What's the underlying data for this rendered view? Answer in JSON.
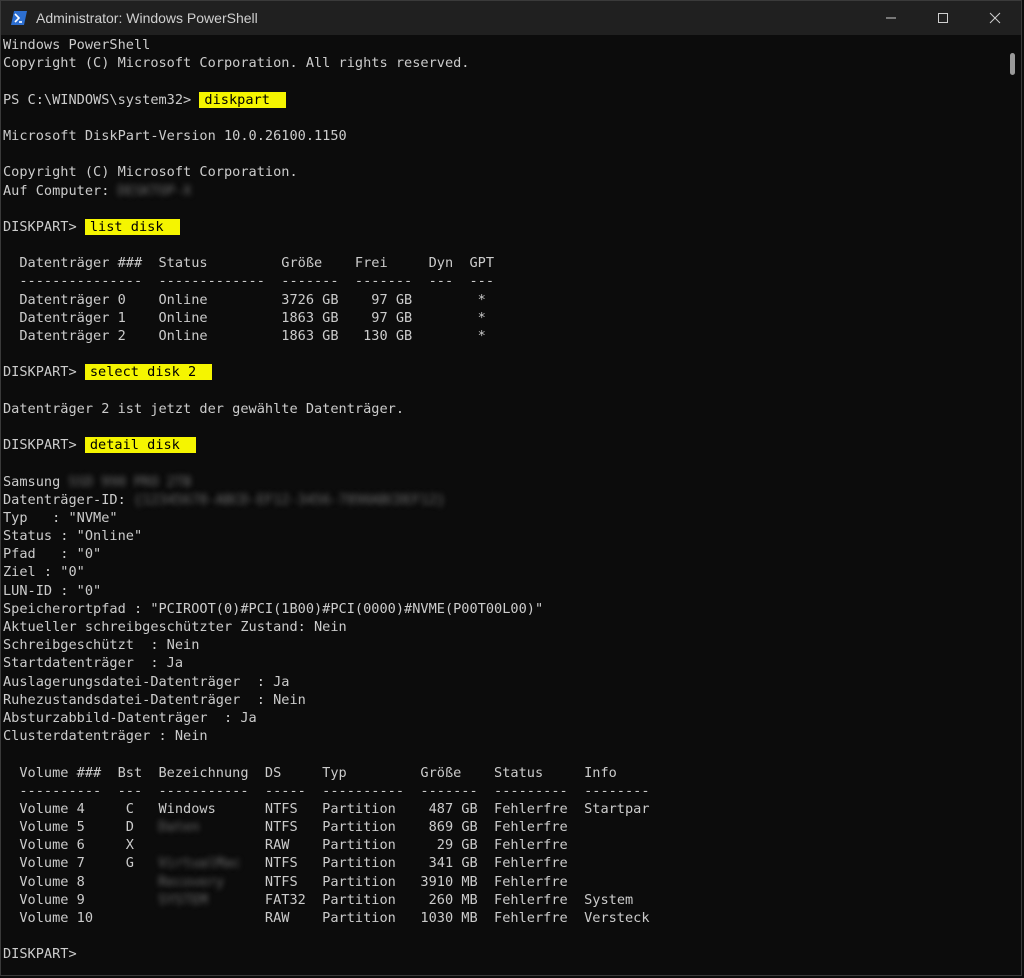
{
  "window": {
    "title": "Administrator: Windows PowerShell",
    "icon": "powershell-icon",
    "controls": {
      "minimize": "minimize-icon",
      "maximize": "maximize-icon",
      "close": "close-icon"
    }
  },
  "colors": {
    "background": "#0c0c0c",
    "text": "#cccccc",
    "highlight": "#f5f500",
    "titlebar": "#202020"
  },
  "console": {
    "lines": [
      {
        "text": "Windows PowerShell"
      },
      {
        "text": "Copyright (C) Microsoft Corporation. All rights reserved."
      },
      {
        "text": ""
      },
      {
        "prompt": "PS C:\\WINDOWS\\system32> ",
        "command": "diskpart"
      },
      {
        "text": ""
      },
      {
        "text": "Microsoft DiskPart-Version 10.0.26100.1150"
      },
      {
        "text": ""
      },
      {
        "text": "Copyright (C) Microsoft Corporation."
      },
      {
        "text": "Auf Computer: ",
        "blurred": "DESKTOP-X"
      },
      {
        "text": ""
      },
      {
        "prompt": "DISKPART> ",
        "command": "list disk"
      },
      {
        "text": ""
      },
      {
        "text": "  Datenträger ###  Status         Größe    Frei     Dyn  GPT"
      },
      {
        "text": "  ---------------  -------------  -------  -------  ---  ---"
      },
      {
        "text": "  Datenträger 0    Online         3726 GB    97 GB        *"
      },
      {
        "text": "  Datenträger 1    Online         1863 GB    97 GB        *"
      },
      {
        "text": "  Datenträger 2    Online         1863 GB   130 GB        *"
      },
      {
        "text": ""
      },
      {
        "prompt": "DISKPART> ",
        "command": "select disk 2"
      },
      {
        "text": ""
      },
      {
        "text": "Datenträger 2 ist jetzt der gewählte Datenträger."
      },
      {
        "text": ""
      },
      {
        "prompt": "DISKPART> ",
        "command": "detail disk"
      },
      {
        "text": ""
      },
      {
        "text": "Samsung ",
        "blurred": "SSD 990 PRO 2TB"
      },
      {
        "text": "Datenträger-ID: ",
        "blurred": "{12345678-ABCD-EF12-3456-7890ABCDEF12}"
      },
      {
        "text": "Typ   : \"NVMe\""
      },
      {
        "text": "Status : \"Online\""
      },
      {
        "text": "Pfad   : \"0\""
      },
      {
        "text": "Ziel : \"0\""
      },
      {
        "text": "LUN-ID : \"0\""
      },
      {
        "text": "Speicherortpfad : \"PCIROOT(0)#PCI(1B00)#PCI(0000)#NVME(P00T00L00)\""
      },
      {
        "text": "Aktueller schreibgeschützter Zustand: Nein"
      },
      {
        "text": "Schreibgeschützt  : Nein"
      },
      {
        "text": "Startdatenträger  : Ja"
      },
      {
        "text": "Auslagerungsdatei-Datenträger  : Ja"
      },
      {
        "text": "Ruhezustandsdatei-Datenträger  : Nein"
      },
      {
        "text": "Absturzabbild-Datenträger  : Ja"
      },
      {
        "text": "Clusterdatenträger : Nein"
      },
      {
        "text": ""
      },
      {
        "text": "  Volume ###  Bst  Bezeichnung  DS     Typ         Größe    Status     Info"
      },
      {
        "text": "  ----------  ---  -----------  -----  ----------  -------  ---------  --------"
      },
      {
        "text": "  Volume 4     C   Windows      NTFS   Partition    487 GB  Fehlerfre  Startpar"
      },
      {
        "text": "  Volume 5     D   ",
        "blurred": "Daten      ",
        "rest": "  NTFS   Partition    869 GB  Fehlerfre"
      },
      {
        "text": "  Volume 6     X                RAW    Partition     29 GB  Fehlerfre"
      },
      {
        "text": "  Volume 7     G   ",
        "blurred": "VirtualMac ",
        "rest": "  NTFS   Partition    341 GB  Fehlerfre"
      },
      {
        "text": "  Volume 8         ",
        "blurred": "Recovery   ",
        "rest": "  NTFS   Partition   3910 MB  Fehlerfre"
      },
      {
        "text": "  Volume 9         ",
        "blurred": "SYSTEM     ",
        "rest": "  FAT32  Partition    260 MB  Fehlerfre  System"
      },
      {
        "text": "  Volume 10                     RAW    Partition   1030 MB  Fehlerfre  Versteck"
      },
      {
        "text": ""
      },
      {
        "prompt": "DISKPART>",
        "command": ""
      }
    ]
  }
}
